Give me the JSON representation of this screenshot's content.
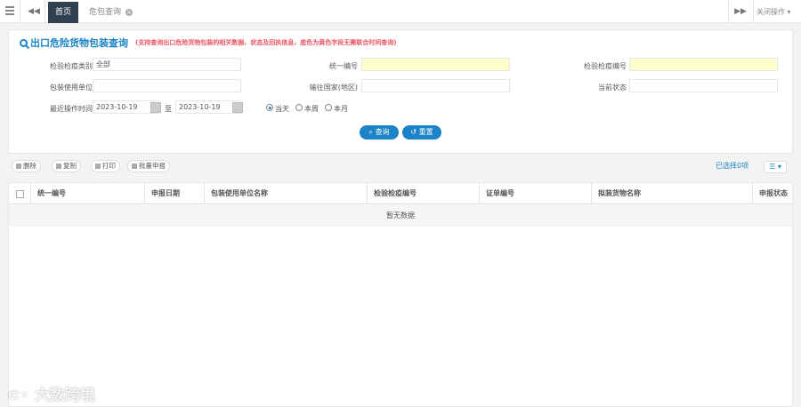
{
  "topbar": {
    "home_tab": "首页",
    "query_tab": "危包查询",
    "close_ops": "关闭操作"
  },
  "panel": {
    "title": "出口危险货物包装查询",
    "subtitle": "(支持查询出口危险货物包装的相关数据、状态及回执信息，底色为黄色字段无需联合时间查询)"
  },
  "form": {
    "category_label": "检验检疫类别",
    "category_value": "全部",
    "unified_no_label": "统一编号",
    "unified_no_value": "",
    "inspection_no_label": "检验检疫编号",
    "inspection_no_value": "",
    "packaging_unit_label": "包装使用单位",
    "packaging_unit_value": "",
    "dest_country_label": "输往国家(地区)",
    "dest_country_value": "",
    "status_label": "当前状态",
    "status_value": "",
    "recent_time_label": "最近操作时间",
    "date_from": "2023-10-19",
    "date_to_sep": "至",
    "date_to": "2023-10-19",
    "radio_today": "当天",
    "radio_week": "本周",
    "radio_month": "本月",
    "query_btn": "查询",
    "reset_btn": "重置"
  },
  "toolbar": {
    "delete": "删除",
    "copy": "复制",
    "print": "打印",
    "batch_report": "批量申报",
    "selected": "已选择0项",
    "columns_icon": "list-icon"
  },
  "table": {
    "headers": [
      "统一编号",
      "申报日期",
      "包装使用单位名称",
      "检验检疫编号",
      "证单编号",
      "拟装货物名称",
      "申报状态"
    ],
    "empty_text": "暂无数据"
  },
  "watermark": "大数跨境",
  "colors": {
    "accent": "#1c84c6",
    "dark_tab": "#2f4050",
    "highlight": "#ffffcc",
    "subtitle_red": "#ed5565"
  }
}
